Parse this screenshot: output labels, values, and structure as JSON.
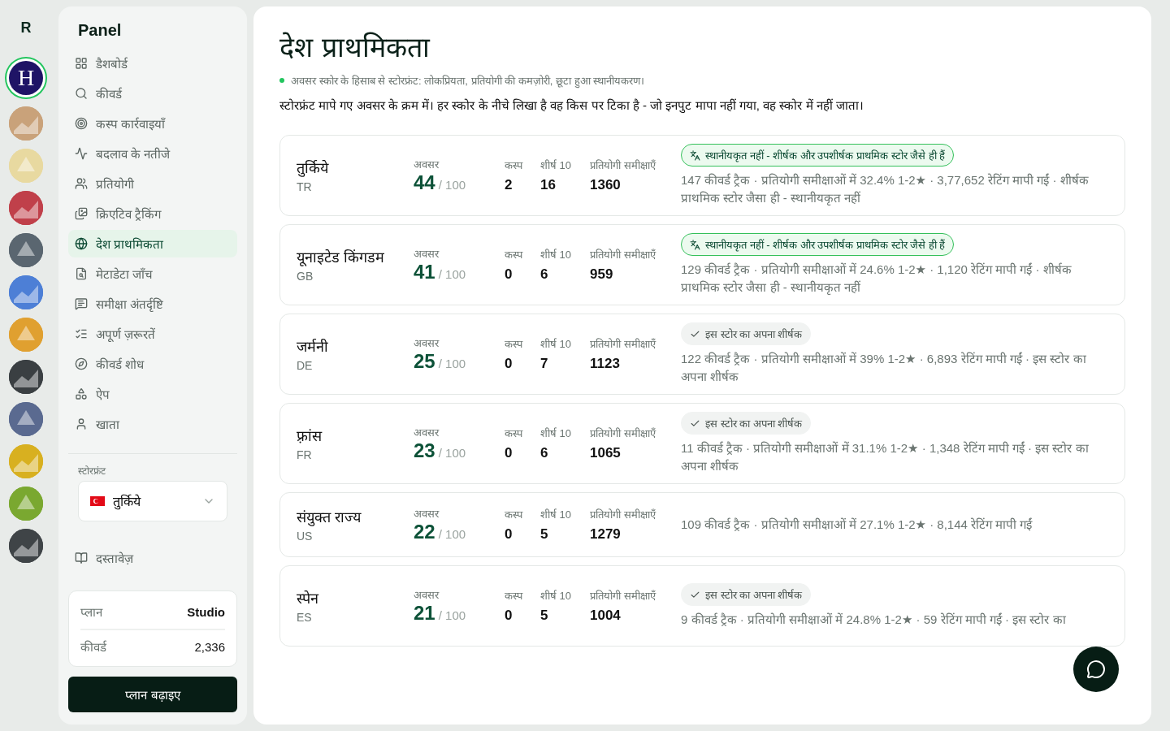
{
  "rail": {
    "logo": "R",
    "apps": [
      {
        "selected": true,
        "letter": "H",
        "color": "#1f1466"
      },
      {
        "selected": false,
        "color": "#c9a27a"
      },
      {
        "selected": false,
        "color": "#e8d9a0"
      },
      {
        "selected": false,
        "color": "#c0404a"
      },
      {
        "selected": false,
        "color": "#5a6670"
      },
      {
        "selected": false,
        "color": "#4d7fd6"
      },
      {
        "selected": false,
        "color": "#e0a030"
      },
      {
        "selected": false,
        "color": "#3a3f42"
      },
      {
        "selected": false,
        "color": "#5a6a90"
      },
      {
        "selected": false,
        "color": "#d8b020"
      },
      {
        "selected": false,
        "color": "#7aa830"
      },
      {
        "selected": false,
        "color": "#3f4447"
      }
    ]
  },
  "sidebar": {
    "title": "Panel",
    "items": [
      {
        "label": "डैशबोर्ड",
        "selected": false
      },
      {
        "label": "कीवर्ड",
        "selected": false
      },
      {
        "label": "कस्प कार्रवाइयाँ",
        "selected": false
      },
      {
        "label": "बदलाव के नतीजे",
        "selected": false
      },
      {
        "label": "प्रतियोगी",
        "selected": false
      },
      {
        "label": "क्रिएटिव ट्रैकिंग",
        "selected": false
      },
      {
        "label": "देश प्राथमिकता",
        "selected": true
      },
      {
        "label": "मेटाडेटा जाँच",
        "selected": false
      },
      {
        "label": "समीक्षा अंतर्दृष्टि",
        "selected": false
      },
      {
        "label": "अपूर्ण ज़रूरतें",
        "selected": false
      },
      {
        "label": "कीवर्ड शोध",
        "selected": false
      },
      {
        "label": "ऐप",
        "selected": false
      },
      {
        "label": "खाता",
        "selected": false
      }
    ],
    "storefront": {
      "label": "स्टोरफ्रंट",
      "value": "तुर्किये"
    },
    "docs": "दस्तावेज़",
    "plan": [
      {
        "label": "प्लान",
        "value": "Studio"
      },
      {
        "label": "कीवर्ड",
        "value": "2,336"
      }
    ],
    "upgrade": "प्लान बढ़ाइए"
  },
  "main": {
    "title": "देश प्राथमिकता",
    "subtitle": "अवसर स्कोर के हिसाब से स्टोरफ्रंट: लोकप्रियता, प्रतियोगी की कमज़ोरी, छूटा हुआ स्थानीयकरण।",
    "intro": "स्टोरफ्रंट मापे गए अवसर के क्रम में। हर स्कोर के नीचे लिखा है वह किस पर टिका है - जो इनपुट मापा नहीं गया, वह स्कोर में नहीं जाता।",
    "countries": [
      {
        "name": "तुर्किये",
        "code": "TR",
        "labels": [
          "अवसर",
          "कस्प",
          "शीर्ष 10",
          "प्रतियोगी समीक्षाएँ"
        ],
        "score": "44",
        "max": "/ 100",
        "cusp": "2",
        "top10": "16",
        "reviews": "1360",
        "badge": {
          "kind": "warning",
          "text": "स्थानीयकृत नहीं - शीर्षक और उपशीर्षक प्राथमिक स्टोर जैसे ही हैं"
        },
        "detail": "147 कीवर्ड ट्रैक · प्रतियोगी समीक्षाओं में 32.4% 1-2★ · 3,77,652 रेटिंग मापी गईं · शीर्षक प्राथमिक स्टोर जैसा ही - स्थानीयकृत नहीं"
      },
      {
        "name": "यूनाइटेड किंगडम",
        "code": "GB",
        "labels": [
          "अवसर",
          "कस्प",
          "शीर्ष 10",
          "प्रतियोगी समीक्षाएँ"
        ],
        "score": "41",
        "max": "/ 100",
        "cusp": "0",
        "top10": "6",
        "reviews": "959",
        "badge": {
          "kind": "warning",
          "text": "स्थानीयकृत नहीं - शीर्षक और उपशीर्षक प्राथमिक स्टोर जैसे ही हैं"
        },
        "detail": "129 कीवर्ड ट्रैक · प्रतियोगी समीक्षाओं में 24.6% 1-2★ · 1,120 रेटिंग मापी गईं · शीर्षक प्राथमिक स्टोर जैसा ही - स्थानीयकृत नहीं"
      },
      {
        "name": "जर्मनी",
        "code": "DE",
        "labels": [
          "अवसर",
          "कस्प",
          "शीर्ष 10",
          "प्रतियोगी समीक्षाएँ"
        ],
        "score": "25",
        "max": "/ 100",
        "cusp": "0",
        "top10": "7",
        "reviews": "1123",
        "badge": {
          "kind": "ok",
          "text": "इस स्टोर का अपना शीर्षक"
        },
        "detail": "122 कीवर्ड ट्रैक · प्रतियोगी समीक्षाओं में 39% 1-2★ · 6,893 रेटिंग मापी गईं · इस स्टोर का अपना शीर्षक"
      },
      {
        "name": "फ़्रांस",
        "code": "FR",
        "labels": [
          "अवसर",
          "कस्प",
          "शीर्ष 10",
          "प्रतियोगी समीक्षाएँ"
        ],
        "score": "23",
        "max": "/ 100",
        "cusp": "0",
        "top10": "6",
        "reviews": "1065",
        "badge": {
          "kind": "ok",
          "text": "इस स्टोर का अपना शीर्षक"
        },
        "detail": "11 कीवर्ड ट्रैक · प्रतियोगी समीक्षाओं में 31.1% 1-2★ · 1,348 रेटिंग मापी गईं · इस स्टोर का अपना शीर्षक"
      },
      {
        "name": "संयुक्त राज्य",
        "code": "US",
        "labels": [
          "अवसर",
          "कस्प",
          "शीर्ष 10",
          "प्रतियोगी समीक्षाएँ"
        ],
        "score": "22",
        "max": "/ 100",
        "cusp": "0",
        "top10": "5",
        "reviews": "1279",
        "detail": "109 कीवर्ड ट्रैक · प्रतियोगी समीक्षाओं में 27.1% 1-2★ · 8,144 रेटिंग मापी गईं"
      },
      {
        "name": "स्पेन",
        "code": "ES",
        "labels": [
          "अवसर",
          "कस्प",
          "शीर्ष 10",
          "प्रतियोगी समीक्षाएँ"
        ],
        "score": "21",
        "max": "/ 100",
        "cusp": "0",
        "top10": "5",
        "reviews": "1004",
        "badge": {
          "kind": "ok",
          "text": "इस स्टोर का अपना शीर्षक"
        },
        "detail": "9 कीवर्ड ट्रैक · प्रतियोगी समीक्षाओं में 24.8% 1-2★ · 59 रेटिंग मापी गईं · इस स्टोर का"
      }
    ]
  }
}
